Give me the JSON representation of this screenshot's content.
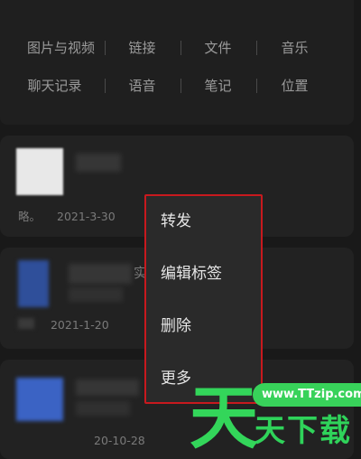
{
  "categories": {
    "row1": [
      "图片与视频",
      "链接",
      "文件",
      "音乐"
    ],
    "row2": [
      "聊天记录",
      "语音",
      "笔记",
      "位置"
    ]
  },
  "items": [
    {
      "sender": "略。",
      "date": "2021-3-30",
      "title_fragment": ""
    },
    {
      "sender": "",
      "date": "2021-1-20",
      "title_fragment": "实"
    },
    {
      "sender": "",
      "date": "20-10-28",
      "title_fragment": ""
    }
  ],
  "context_menu": {
    "items": [
      "转发",
      "编辑标签",
      "删除",
      "更多"
    ]
  },
  "watermark": {
    "url": "www.TTzip.com",
    "big_char": "天",
    "text": "天下载"
  },
  "colors": {
    "background": "#191919",
    "card": "#222222",
    "menu_border": "#c8191e",
    "watermark_green": "#33d65a"
  }
}
